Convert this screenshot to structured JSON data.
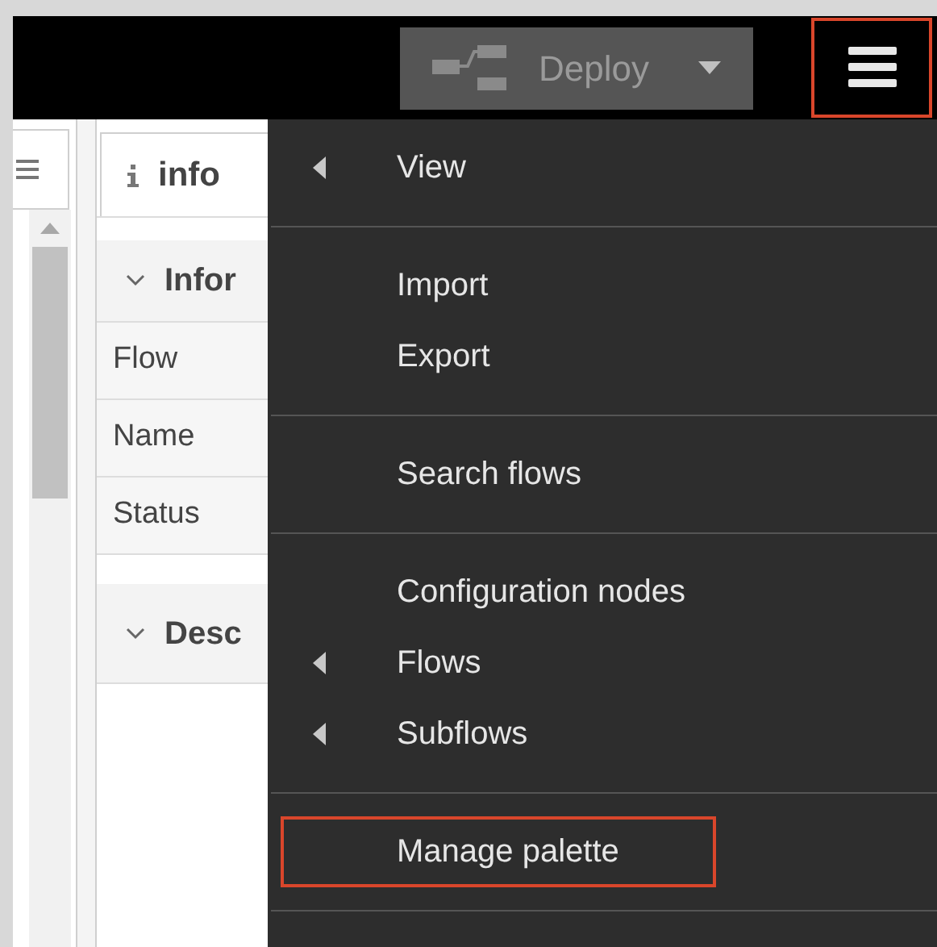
{
  "header": {
    "deploy": {
      "label": "Deploy",
      "disabled": true
    },
    "menu_button": {
      "highlighted": true
    }
  },
  "sidebar": {
    "tab": {
      "label": "info",
      "selected": true
    },
    "sections": [
      {
        "title": "Infor",
        "expanded": true,
        "rows": [
          {
            "label": "Flow"
          },
          {
            "label": "Name"
          },
          {
            "label": "Status"
          }
        ]
      },
      {
        "title": "Desc",
        "expanded": true
      }
    ]
  },
  "menu": {
    "groups": [
      [
        {
          "label": "View",
          "submenu": true,
          "highlighted": false
        }
      ],
      [
        {
          "label": "Import",
          "submenu": false,
          "highlighted": false
        },
        {
          "label": "Export",
          "submenu": false,
          "highlighted": false
        }
      ],
      [
        {
          "label": "Search flows",
          "submenu": false,
          "highlighted": false
        }
      ],
      [
        {
          "label": "Configuration nodes",
          "submenu": false,
          "highlighted": false
        },
        {
          "label": "Flows",
          "submenu": true,
          "highlighted": false
        },
        {
          "label": "Subflows",
          "submenu": true,
          "highlighted": false
        }
      ],
      [
        {
          "label": "Manage palette",
          "submenu": false,
          "highlighted": true
        }
      ]
    ]
  }
}
